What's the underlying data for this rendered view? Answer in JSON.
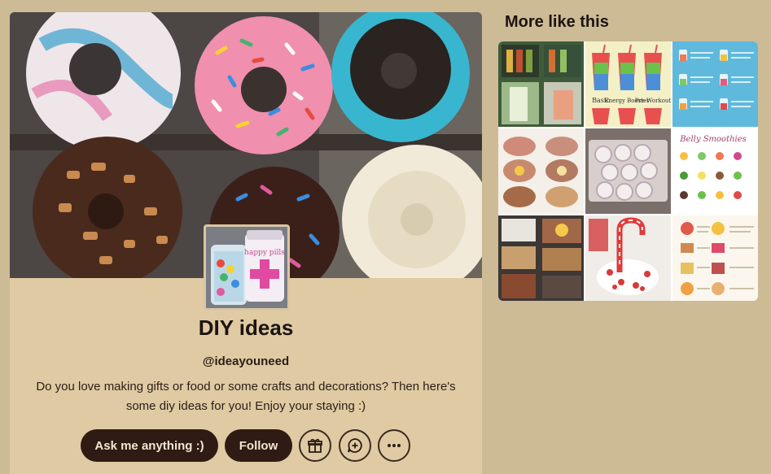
{
  "blog": {
    "title": "DIY ideas",
    "handle": "@ideayouneed",
    "description": "Do you love making gifts or food or some crafts and decorations? Then here's some diy ideas for you! Enjoy your staying :)"
  },
  "actions": {
    "ask_label": "Ask me anything :)",
    "follow_label": "Follow",
    "icons": [
      "gift-icon",
      "new-message-icon",
      "more-options-icon"
    ]
  },
  "colors": {
    "page_background": "#cdbb96",
    "card_background": "#dfcaa3",
    "button_dark": "#2f1b13",
    "button_text": "#f2e6d3"
  },
  "sidebar": {
    "heading": "More like this",
    "avatar_label": "happy pills",
    "tile_labels": [
      "Basic",
      "Energy Booster",
      "Pre Workout",
      "Belly Smoothies"
    ]
  }
}
